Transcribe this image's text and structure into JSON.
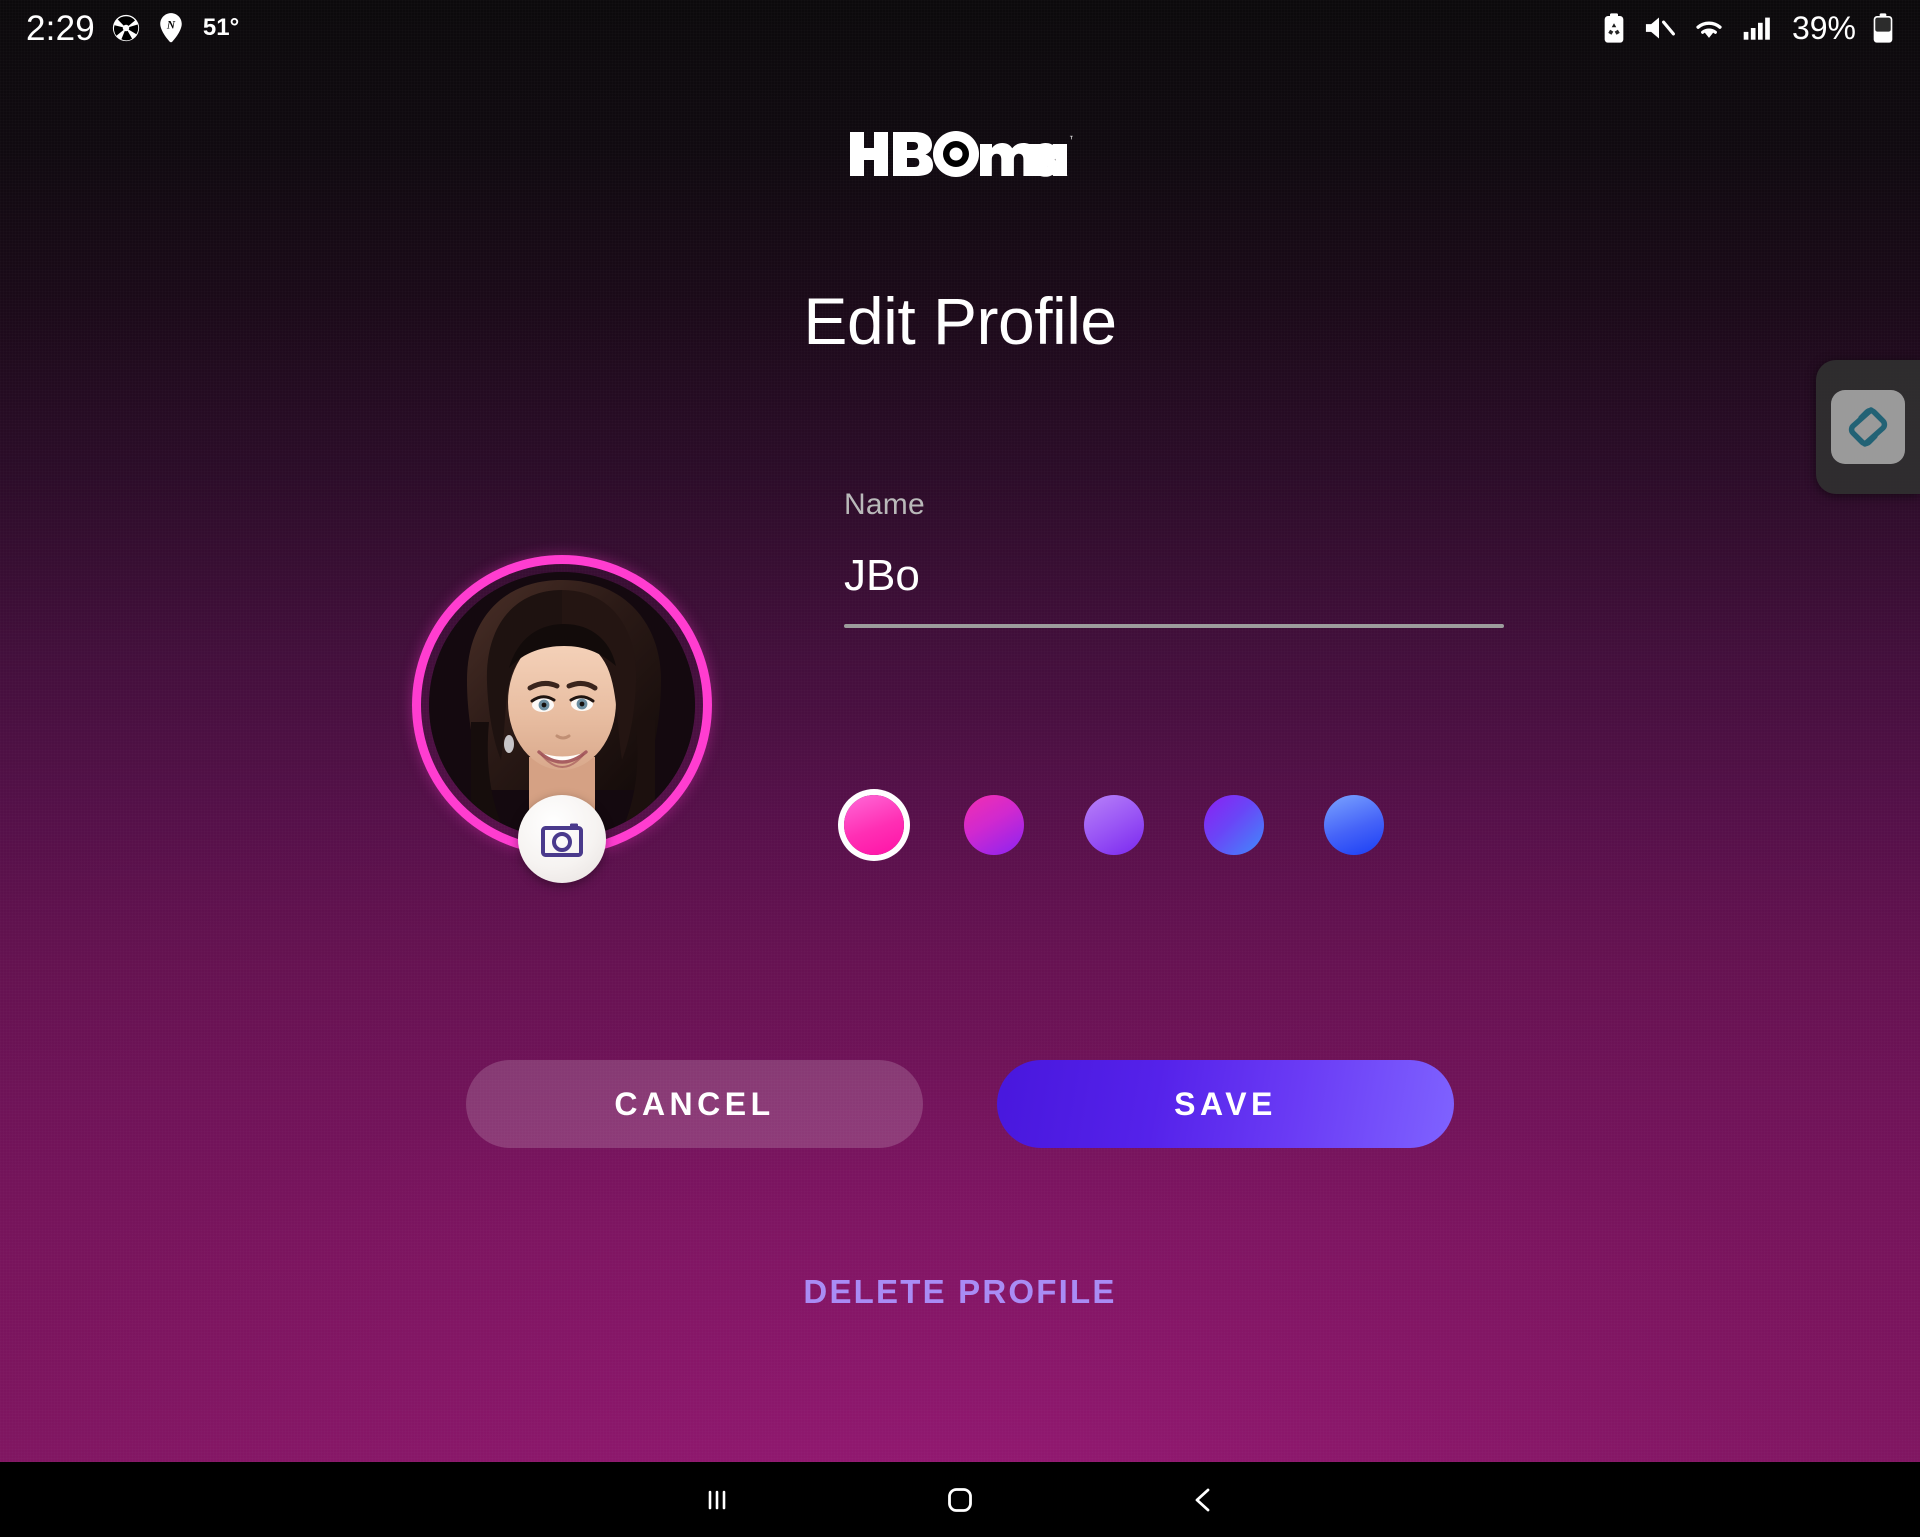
{
  "status_bar": {
    "time": "2:29",
    "temperature": "51°",
    "battery_percent": "39%",
    "icons": [
      "camera-shutter-icon",
      "navigation-pin-icon",
      "battery-saver-icon",
      "mute-icon",
      "wifi-icon",
      "cellular-signal-icon",
      "battery-icon"
    ]
  },
  "app": {
    "brand": "HBO max",
    "brand_hbo": "HBO",
    "brand_max": "max",
    "trademark": "™",
    "title": "Edit Profile"
  },
  "avatar": {
    "ring_color": "#ff3dd0",
    "camera_button_label": "camera-icon",
    "alt": "profile-photo-woman-dark-bob-hair"
  },
  "form": {
    "name_label": "Name",
    "name_value": "JBo",
    "name_placeholder": "Name"
  },
  "colors": {
    "selected_index": 0,
    "swatches": [
      {
        "name": "pink",
        "from": "#ff57d4",
        "to": "#ff1aa8",
        "selected": true
      },
      {
        "name": "magenta-purple",
        "from": "#f32fb0",
        "to": "#8a23f2",
        "selected": false
      },
      {
        "name": "violet",
        "from": "#b06cf5",
        "to": "#7a27ef",
        "selected": false
      },
      {
        "name": "purple-blue",
        "from": "#8c1ff2",
        "to": "#3f8cfb",
        "selected": false
      },
      {
        "name": "blue",
        "from": "#6f9bff",
        "to": "#1a3ef5",
        "selected": false
      }
    ]
  },
  "actions": {
    "cancel_label": "CANCEL",
    "save_label": "SAVE",
    "delete_label": "DELETE PROFILE",
    "save_gradient_from": "#4817dd",
    "save_gradient_to": "#7f63ff",
    "delete_color": "#a98cf5"
  },
  "side_app": {
    "name": "edge-panel-app-icon"
  },
  "nav_bar": {
    "recents_label": "recents-icon",
    "home_label": "home-icon",
    "back_label": "back-icon"
  }
}
